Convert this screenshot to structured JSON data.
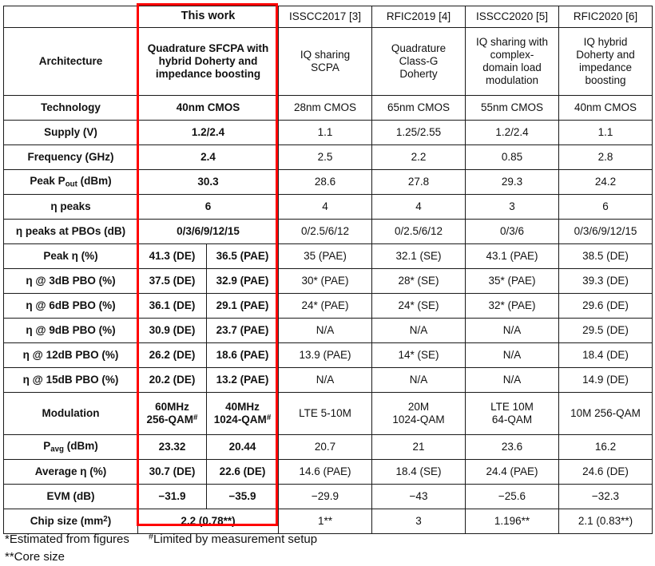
{
  "table": {
    "columns": [
      {
        "key": "label",
        "label": ""
      },
      {
        "key": "this_work",
        "label": "This work"
      },
      {
        "key": "isscc2017",
        "label": "ISSCC2017 [3]"
      },
      {
        "key": "rfic2019",
        "label": "RFIC2019 [4]"
      },
      {
        "key": "isscc2020",
        "label": "ISSCC2020 [5]"
      },
      {
        "key": "rfic2020",
        "label": "RFIC2020 [6]"
      }
    ],
    "rows": [
      {
        "label": "Architecture",
        "this_work": "Quadrature SFCPA with hybrid Doherty and impedance boosting",
        "isscc2017": "IQ sharing SCPA",
        "rfic2019": "Quadrature Class-G Doherty",
        "isscc2020": "IQ sharing with complex-domain load modulation",
        "rfic2020": "IQ hybrid Doherty and impedance boosting"
      },
      {
        "label": "Technology",
        "this_work": "40nm CMOS",
        "isscc2017": "28nm CMOS",
        "rfic2019": "65nm CMOS",
        "isscc2020": "55nm CMOS",
        "rfic2020": "40nm CMOS"
      },
      {
        "label": "Supply (V)",
        "this_work": "1.2/2.4",
        "isscc2017": "1.1",
        "rfic2019": "1.25/2.55",
        "isscc2020": "1.2/2.4",
        "rfic2020": "1.1"
      },
      {
        "label": "Frequency (GHz)",
        "this_work": "2.4",
        "isscc2017": "2.5",
        "rfic2019": "2.2",
        "isscc2020": "0.85",
        "rfic2020": "2.8"
      },
      {
        "label": "Peak Pout (dBm)",
        "this_work": "30.3",
        "isscc2017": "28.6",
        "rfic2019": "27.8",
        "isscc2020": "29.3",
        "rfic2020": "24.2"
      },
      {
        "label": "η peaks",
        "this_work": "6",
        "isscc2017": "4",
        "rfic2019": "4",
        "isscc2020": "3",
        "rfic2020": "6"
      },
      {
        "label": "η peaks at PBOs (dB)",
        "this_work": "0/3/6/9/12/15",
        "isscc2017": "0/2.5/6/12",
        "rfic2019": "0/2.5/6/12",
        "isscc2020": "0/3/6",
        "rfic2020": "0/3/6/9/12/15"
      },
      {
        "label": "Peak η (%)",
        "this_work_a": "41.3 (DE)",
        "this_work_b": "36.5 (PAE)",
        "isscc2017": "35 (PAE)",
        "rfic2019": "32.1 (SE)",
        "isscc2020": "43.1 (PAE)",
        "rfic2020": "38.5 (DE)"
      },
      {
        "label": "η @ 3dB PBO (%)",
        "this_work_a": "37.5 (DE)",
        "this_work_b": "32.9 (PAE)",
        "isscc2017": "30* (PAE)",
        "rfic2019": "28* (SE)",
        "isscc2020": "35* (PAE)",
        "rfic2020": "39.3 (DE)"
      },
      {
        "label": "η @ 6dB PBO (%)",
        "this_work_a": "36.1 (DE)",
        "this_work_b": "29.1 (PAE)",
        "isscc2017": "24* (PAE)",
        "rfic2019": "24* (SE)",
        "isscc2020": "32* (PAE)",
        "rfic2020": "29.6 (DE)"
      },
      {
        "label": "η @ 9dB PBO (%)",
        "this_work_a": "30.9 (DE)",
        "this_work_b": "23.7 (PAE)",
        "isscc2017": "N/A",
        "rfic2019": "N/A",
        "isscc2020": "N/A",
        "rfic2020": "29.5 (DE)"
      },
      {
        "label": "η @ 12dB PBO (%)",
        "this_work_a": "26.2 (DE)",
        "this_work_b": "18.6 (PAE)",
        "isscc2017": "13.9 (PAE)",
        "rfic2019": "14* (SE)",
        "isscc2020": "N/A",
        "rfic2020": "18.4 (DE)"
      },
      {
        "label": "η @ 15dB PBO (%)",
        "this_work_a": "20.2 (DE)",
        "this_work_b": "13.2 (PAE)",
        "isscc2017": "N/A",
        "rfic2019": "N/A",
        "isscc2020": "N/A",
        "rfic2020": "14.9 (DE)"
      },
      {
        "label": "Modulation",
        "this_work_a": "60MHz 256-QAM#",
        "this_work_b": "40MHz 1024-QAM#",
        "isscc2017": "LTE 5-10M",
        "rfic2019": "20M 1024-QAM",
        "isscc2020": "LTE 10M 64-QAM",
        "rfic2020": "10M 256-QAM"
      },
      {
        "label": "Pavg (dBm)",
        "this_work_a": "23.32",
        "this_work_b": "20.44",
        "isscc2017": "20.7",
        "rfic2019": "21",
        "isscc2020": "23.6",
        "rfic2020": "16.2"
      },
      {
        "label": "Average η (%)",
        "this_work_a": "30.7 (DE)",
        "this_work_b": "22.6 (DE)",
        "isscc2017": "14.6 (PAE)",
        "rfic2019": "18.4 (SE)",
        "isscc2020": "24.4 (PAE)",
        "rfic2020": "24.6 (DE)"
      },
      {
        "label": "EVM (dB)",
        "this_work_a": "−31.9",
        "this_work_b": "−35.9",
        "isscc2017": "−29.9",
        "rfic2019": "−43",
        "isscc2020": "−25.6",
        "rfic2020": "−32.3"
      },
      {
        "label": "Chip size (mm2)",
        "this_work": "2.2 (0.78**)",
        "isscc2017": "1**",
        "rfic2019": "3",
        "isscc2020": "1.196**",
        "rfic2020": "2.1 (0.83**)"
      }
    ]
  },
  "cells": {
    "header": {
      "empty": "",
      "this_work": "This work",
      "isscc2017": "ISSCC2017 [3]",
      "rfic2019": "RFIC2019 [4]",
      "isscc2020": "ISSCC2020 [5]",
      "rfic2020": "RFIC2020 [6]"
    },
    "architecture": {
      "label": "Architecture",
      "this_work_l1": "Quadrature SFCPA with",
      "this_work_l2": "hybrid Doherty and",
      "this_work_l3": "impedance boosting",
      "isscc2017_l1": "IQ sharing",
      "isscc2017_l2": "SCPA",
      "rfic2019_l1": "Quadrature",
      "rfic2019_l2": "Class-G",
      "rfic2019_l3": "Doherty",
      "isscc2020_l1": "IQ sharing with",
      "isscc2020_l2": "complex-",
      "isscc2020_l3": "domain load",
      "isscc2020_l4": "modulation",
      "rfic2020_l1": "IQ hybrid",
      "rfic2020_l2": "Doherty and",
      "rfic2020_l3": "impedance",
      "rfic2020_l4": "boosting"
    },
    "technology": {
      "label": "Technology",
      "this_work": "40nm CMOS",
      "isscc2017": "28nm CMOS",
      "rfic2019": "65nm CMOS",
      "isscc2020": "55nm CMOS",
      "rfic2020": "40nm CMOS"
    },
    "supply": {
      "label": "Supply (V)",
      "this_work": "1.2/2.4",
      "isscc2017": "1.1",
      "rfic2019": "1.25/2.55",
      "isscc2020": "1.2/2.4",
      "rfic2020": "1.1"
    },
    "frequency": {
      "label": "Frequency (GHz)",
      "this_work": "2.4",
      "isscc2017": "2.5",
      "rfic2019": "2.2",
      "isscc2020": "0.85",
      "rfic2020": "2.8"
    },
    "peak_pout": {
      "label_pre": "Peak P",
      "label_sub": "out",
      "label_post": " (dBm)",
      "this_work": "30.3",
      "isscc2017": "28.6",
      "rfic2019": "27.8",
      "isscc2020": "29.3",
      "rfic2020": "24.2"
    },
    "eta_peaks": {
      "label": "η peaks",
      "this_work": "6",
      "isscc2017": "4",
      "rfic2019": "4",
      "isscc2020": "3",
      "rfic2020": "6"
    },
    "eta_peaks_pbo": {
      "label": "η peaks at PBOs (dB)",
      "this_work": "0/3/6/9/12/15",
      "isscc2017": "0/2.5/6/12",
      "rfic2019": "0/2.5/6/12",
      "isscc2020": "0/3/6",
      "rfic2020": "0/3/6/9/12/15"
    },
    "peak_eta": {
      "label": "Peak η (%)",
      "tw_a": "41.3 (DE)",
      "tw_b": "36.5 (PAE)",
      "isscc2017": "35 (PAE)",
      "rfic2019": "32.1 (SE)",
      "isscc2020": "43.1 (PAE)",
      "rfic2020": "38.5 (DE)"
    },
    "eta_3db": {
      "label": "η @ 3dB PBO (%)",
      "tw_a": "37.5 (DE)",
      "tw_b": "32.9 (PAE)",
      "isscc2017": "30* (PAE)",
      "rfic2019": "28* (SE)",
      "isscc2020": "35* (PAE)",
      "rfic2020": "39.3 (DE)"
    },
    "eta_6db": {
      "label": "η @ 6dB PBO (%)",
      "tw_a": "36.1 (DE)",
      "tw_b": "29.1 (PAE)",
      "isscc2017": "24* (PAE)",
      "rfic2019": "24* (SE)",
      "isscc2020": "32* (PAE)",
      "rfic2020": "29.6 (DE)"
    },
    "eta_9db": {
      "label": "η @ 9dB PBO (%)",
      "tw_a": "30.9 (DE)",
      "tw_b": "23.7 (PAE)",
      "isscc2017": "N/A",
      "rfic2019": "N/A",
      "isscc2020": "N/A",
      "rfic2020": "29.5 (DE)"
    },
    "eta_12db": {
      "label": "η @ 12dB PBO (%)",
      "tw_a": "26.2 (DE)",
      "tw_b": "18.6 (PAE)",
      "isscc2017": "13.9 (PAE)",
      "rfic2019": "14* (SE)",
      "isscc2020": "N/A",
      "rfic2020": "18.4 (DE)"
    },
    "eta_15db": {
      "label": "η @ 15dB PBO (%)",
      "tw_a": "20.2 (DE)",
      "tw_b": "13.2 (PAE)",
      "isscc2017": "N/A",
      "rfic2019": "N/A",
      "isscc2020": "N/A",
      "rfic2020": "14.9 (DE)"
    },
    "modulation": {
      "label": "Modulation",
      "tw_a_l1": "60MHz",
      "tw_a_l2": "256-QAM",
      "tw_a_sup": "#",
      "tw_b_l1": "40MHz",
      "tw_b_l2": "1024-QAM",
      "tw_b_sup": "#",
      "isscc2017": "LTE 5-10M",
      "rfic2019_l1": "20M",
      "rfic2019_l2": "1024-QAM",
      "isscc2020_l1": "LTE 10M",
      "isscc2020_l2": "64-QAM",
      "rfic2020": "10M 256-QAM"
    },
    "pavg": {
      "label_pre": "P",
      "label_sub": "avg",
      "label_post": " (dBm)",
      "tw_a": "23.32",
      "tw_b": "20.44",
      "isscc2017": "20.7",
      "rfic2019": "21",
      "isscc2020": "23.6",
      "rfic2020": "16.2"
    },
    "average_eta": {
      "label": "Average η (%)",
      "tw_a": "30.7 (DE)",
      "tw_b": "22.6 (DE)",
      "isscc2017": "14.6 (PAE)",
      "rfic2019": "18.4 (SE)",
      "isscc2020": "24.4 (PAE)",
      "rfic2020": "24.6 (DE)"
    },
    "evm": {
      "label": "EVM (dB)",
      "tw_a": "−31.9",
      "tw_b": "−35.9",
      "isscc2017": "−29.9",
      "rfic2019": "−43",
      "isscc2020": "−25.6",
      "rfic2020": "−32.3"
    },
    "chip_size": {
      "label_pre": "Chip size (mm",
      "label_sup": "2",
      "label_post": ")",
      "this_work": "2.2 (0.78**)",
      "isscc2017": "1**",
      "rfic2019": "3",
      "isscc2020": "1.196**",
      "rfic2020": "2.1 (0.83**)"
    }
  },
  "footnotes": {
    "estimated": "*Estimated from figures",
    "limited_sup": "#",
    "limited": "Limited by measurement setup",
    "core": "**Core size"
  },
  "colors": {
    "highlight": "#ff0000",
    "grid": "#1a1a1a",
    "background": "#ffffff",
    "text": "#111111"
  }
}
